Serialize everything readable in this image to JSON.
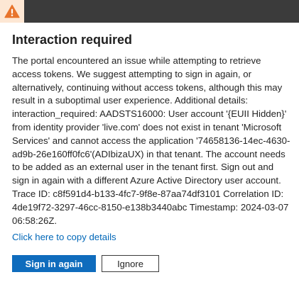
{
  "colors": {
    "topbar": "#3b3b3b",
    "warning_tab": "#fde7d4",
    "warning_icon": "#e8742c",
    "link": "#0067b8",
    "primary_button": "#0f6cbd"
  },
  "header": {
    "icon": "warning-icon"
  },
  "dialog": {
    "title": "Interaction required",
    "message": "The portal encountered an issue while attempting to retrieve access tokens. We suggest attempting to sign in again, or alternatively, continuing without access tokens, although this may result in a suboptimal user experience. Additional details: interaction_required: AADSTS16000: User account '{EUII Hidden}' from identity provider 'live.com' does not exist in tenant 'Microsoft Services' and cannot access the application '74658136-14ec-4630-ad9b-26e160ff0fc6'(ADIbizaUX) in that tenant. The account needs to be added as an external user in the tenant first. Sign out and sign in again with a different Azure Active Directory user account. Trace ID: c8f591d4-b133-4fc7-9f8e-87aa74df3101 Correlation ID: 4de19f72-3297-46cc-8150-e138b3440abc Timestamp: 2024-03-07 06:58:26Z.",
    "copy_link": "Click here to copy details",
    "sign_in_label": "Sign in again",
    "ignore_label": "Ignore"
  }
}
